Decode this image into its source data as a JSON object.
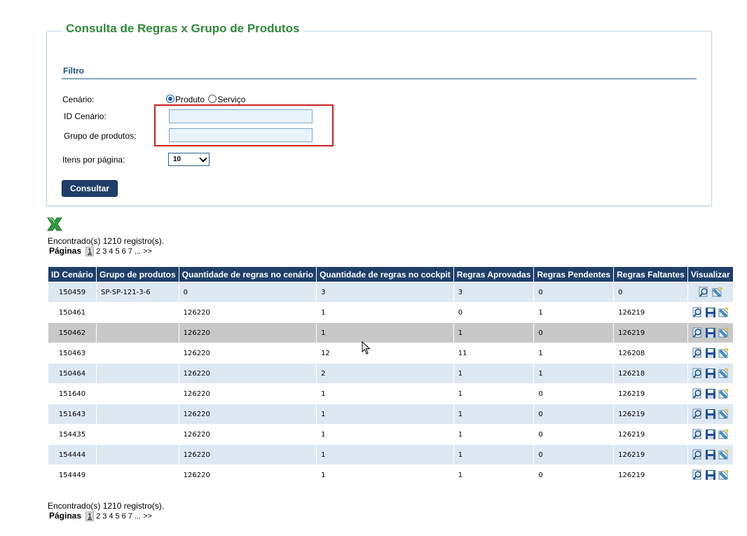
{
  "title": "Consulta de Regras x Grupo de Produtos",
  "filter": {
    "section_title": "Filtro",
    "cenario_label": "Cenário:",
    "radio_produto": "Produto",
    "radio_servico": "Serviço",
    "id_cenario_label": "ID Cenário:",
    "id_cenario_value": "",
    "grupo_label": "Grupo de produtos:",
    "grupo_value": "",
    "itens_label": "Itens por página:",
    "itens_value": "10",
    "consultar_label": "Consultar"
  },
  "results": {
    "found_text": "Encontrado(s) 1210 registro(s).",
    "pages_label": "Páginas",
    "pages": [
      "1",
      "2",
      "3",
      "4",
      "5",
      "6",
      "7"
    ],
    "more": "... >>"
  },
  "table": {
    "headers": [
      "ID Cenário",
      "Grupo de produtos",
      "Quantidade de regras no cenário",
      "Quantidade de regras no cockpit",
      "Regras Aprovadas",
      "Regras Pendentes",
      "Regras Faltantes",
      "Visualizar"
    ],
    "rows": [
      [
        "150459",
        "SP-SP-121-3-6",
        "0",
        "3",
        "3",
        "0",
        "0"
      ],
      [
        "150461",
        "",
        "126220",
        "1",
        "0",
        "1",
        "126219"
      ],
      [
        "150462",
        "",
        "126220",
        "1",
        "1",
        "0",
        "126219"
      ],
      [
        "150463",
        "",
        "126220",
        "12",
        "11",
        "1",
        "126208"
      ],
      [
        "150464",
        "",
        "126220",
        "2",
        "1",
        "1",
        "126218"
      ],
      [
        "151640",
        "",
        "126220",
        "1",
        "1",
        "0",
        "126219"
      ],
      [
        "151643",
        "",
        "126220",
        "1",
        "1",
        "0",
        "126219"
      ],
      [
        "154435",
        "",
        "126220",
        "1",
        "1",
        "0",
        "126219"
      ],
      [
        "154444",
        "",
        "126220",
        "1",
        "1",
        "0",
        "126219"
      ],
      [
        "154449",
        "",
        "126220",
        "1",
        "1",
        "0",
        "126219"
      ]
    ]
  },
  "icons": {
    "export": "excel-icon",
    "view": "magnifier-icon",
    "save": "save-icon",
    "edit": "edit-icon"
  },
  "colors": {
    "title_green": "#2e8b3a",
    "header_navy": "#1f3f6a",
    "highlight_red": "#cc2222"
  }
}
